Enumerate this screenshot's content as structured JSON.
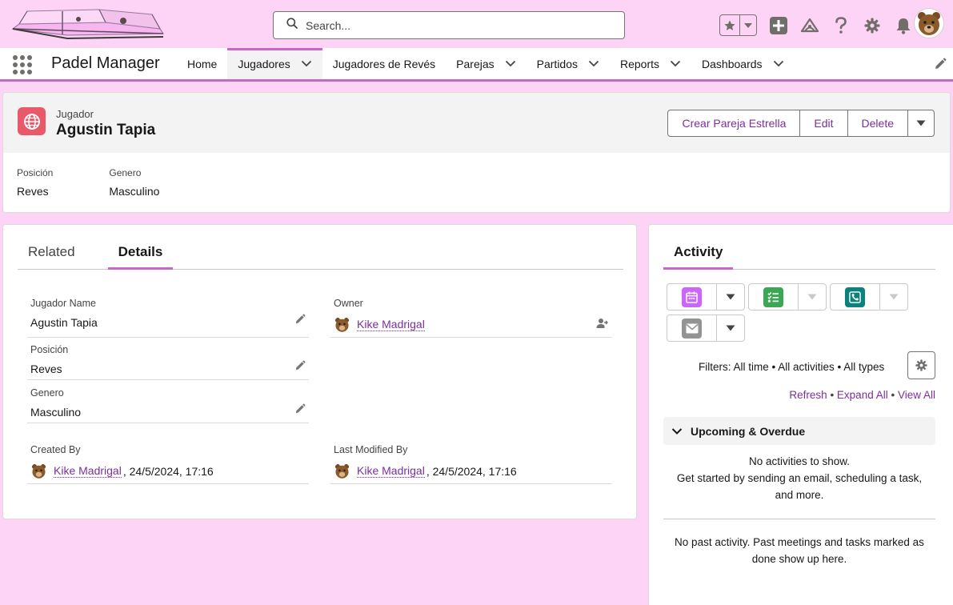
{
  "header": {
    "search_placeholder": "Search...",
    "icons": [
      "favorites-star-icon",
      "chevron-down-icon",
      "add-icon",
      "trailhead-icon",
      "help-icon",
      "setup-gear-icon",
      "notifications-bell-icon",
      "user-avatar"
    ]
  },
  "nav": {
    "app_name": "Padel Manager",
    "tabs": [
      {
        "label": "Home",
        "has_menu": false,
        "active": false
      },
      {
        "label": "Jugadores",
        "has_menu": true,
        "active": true
      },
      {
        "label": "Jugadores de Revés",
        "has_menu": false,
        "active": false
      },
      {
        "label": "Parejas",
        "has_menu": true,
        "active": false
      },
      {
        "label": "Partidos",
        "has_menu": true,
        "active": false
      },
      {
        "label": "Reports",
        "has_menu": true,
        "active": false
      },
      {
        "label": "Dashboards",
        "has_menu": true,
        "active": false
      }
    ]
  },
  "record": {
    "object_type": "Jugador",
    "name": "Agustin Tapia",
    "actions": [
      "Crear Pareja Estrella",
      "Edit",
      "Delete"
    ],
    "highlights": [
      {
        "label": "Posición",
        "value": "Reves"
      },
      {
        "label": "Genero",
        "value": "Masculino"
      }
    ]
  },
  "details": {
    "tabs": [
      "Related",
      "Details"
    ],
    "active_tab": "Details",
    "jugador_name": {
      "label": "Jugador Name",
      "value": "Agustin Tapia"
    },
    "owner": {
      "label": "Owner",
      "value": "Kike Madrigal"
    },
    "posicion": {
      "label": "Posición",
      "value": "Reves"
    },
    "genero": {
      "label": "Genero",
      "value": "Masculino"
    },
    "created_by": {
      "label": "Created By",
      "user": "Kike Madrigal",
      "date": ", 24/5/2024, 17:16"
    },
    "last_modified_by": {
      "label": "Last Modified By",
      "user": "Kike Madrigal",
      "date": ", 24/5/2024, 17:16"
    }
  },
  "activity": {
    "tab": "Activity",
    "filters": "Filters: All time • All activities • All types",
    "refresh": "Refresh",
    "expand_all": "Expand All",
    "view_all": "View All",
    "upcoming_title": "Upcoming & Overdue",
    "no_activities_1": "No activities to show.",
    "no_activities_2": "Get started by sending an email, scheduling a task,",
    "no_activities_3": "and more.",
    "past_1": "No past activity. Past meetings and tasks marked as",
    "past_2": "done show up here.",
    "colors": {
      "event": "#cb65ff",
      "task": "#3ba755",
      "call": "#0b827c",
      "email": "#939393"
    }
  },
  "colors": {
    "background": "#fdd3f6",
    "accent": "#c768c7",
    "link": "#7b2f9e",
    "record_icon": "#e8596a"
  }
}
